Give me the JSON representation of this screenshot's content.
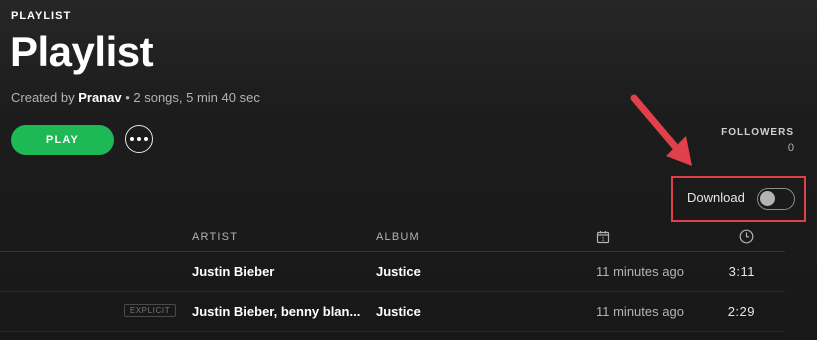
{
  "header": {
    "eyebrow": "PLAYLIST",
    "title": "Playlist",
    "created_by_prefix": "Created by",
    "owner": "Pranav",
    "summary": " • 2 songs, 5 min 40 sec"
  },
  "actions": {
    "play_label": "PLAY",
    "more_icon": "more-horizontal-icon"
  },
  "followers": {
    "label": "FOLLOWERS",
    "count": "0"
  },
  "download": {
    "label": "Download",
    "enabled": false,
    "highlight_color": "#e0404a"
  },
  "table": {
    "columns": {
      "artist": "ARTIST",
      "album": "ALBUM",
      "added_icon": "calendar-icon",
      "duration_icon": "clock-icon"
    },
    "rows": [
      {
        "explicit": "",
        "artist": "Justin Bieber",
        "album": "Justice",
        "added": "11 minutes ago",
        "duration": "3:11"
      },
      {
        "explicit": "EXPLICIT",
        "artist": "Justin Bieber, benny blan...",
        "album": "Justice",
        "added": "11 minutes ago",
        "duration": "2:29"
      }
    ]
  },
  "colors": {
    "accent_green": "#1db954",
    "annotation_red": "#e0404a"
  },
  "annotation": {
    "arrow_icon": "red-arrow-icon"
  }
}
